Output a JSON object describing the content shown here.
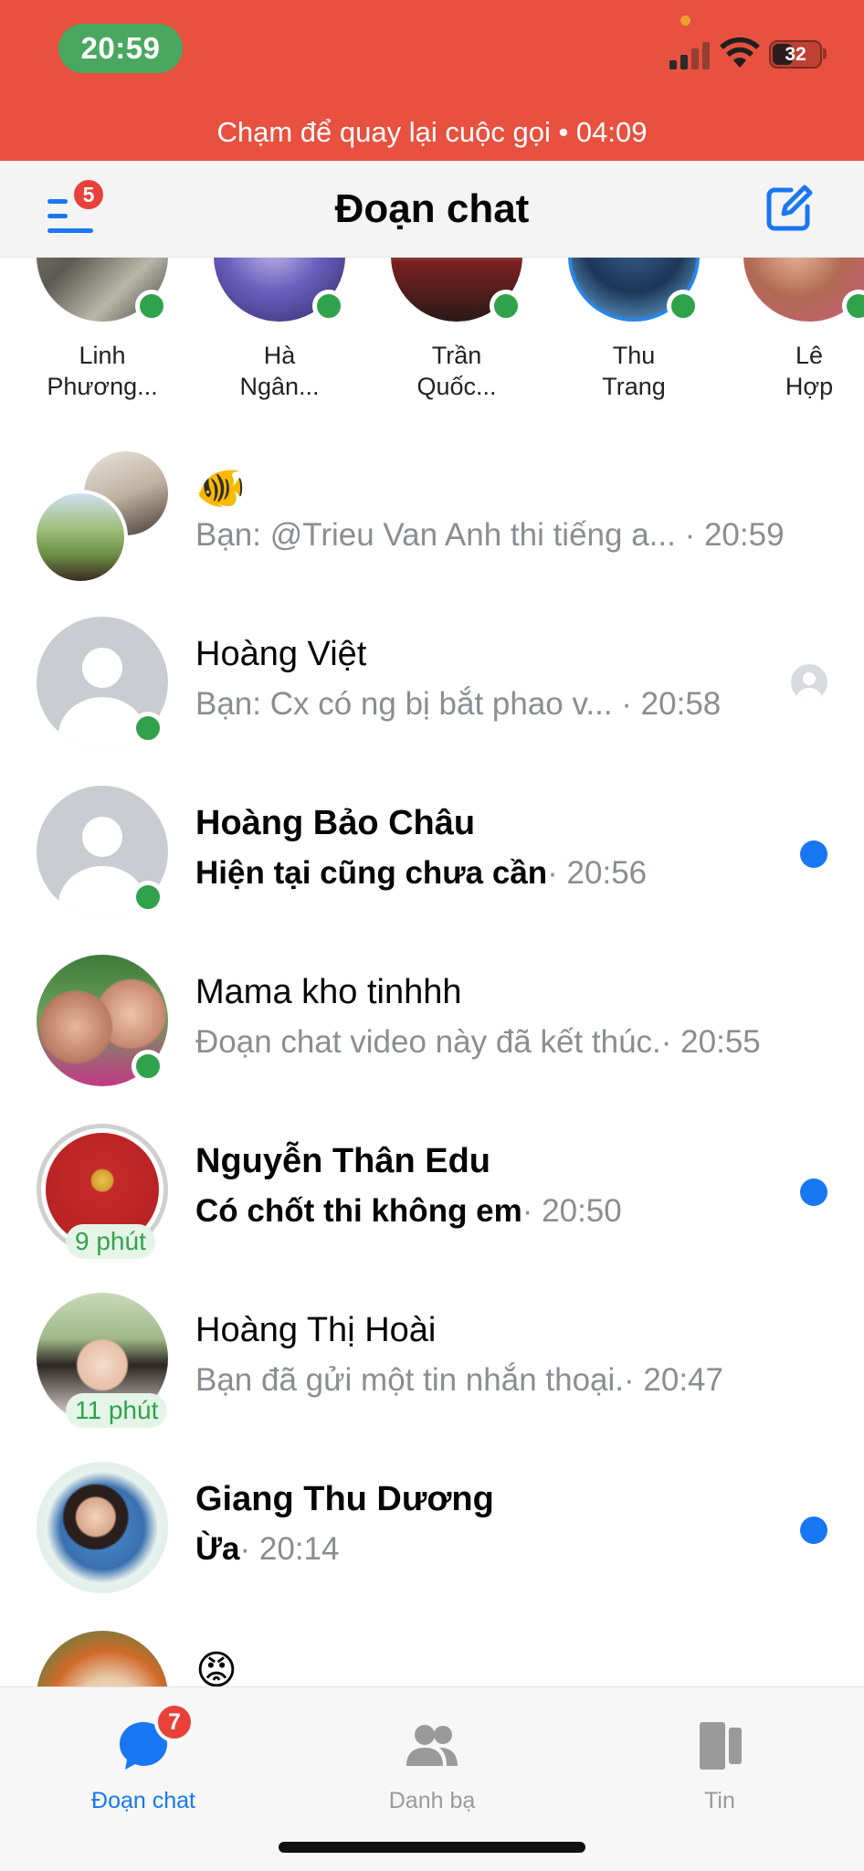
{
  "status_bar": {
    "time": "20:59",
    "battery": "32"
  },
  "call_banner": {
    "text": "Chạm để quay lại cuộc gọi • 04:09"
  },
  "header": {
    "title": "Đoạn chat",
    "menu_badge": "5"
  },
  "stories": [
    {
      "name": "Linh\nPhương..."
    },
    {
      "name": "Hà\nNgân..."
    },
    {
      "name": "Trần\nQuốc..."
    },
    {
      "name": "Thu\nTrang"
    },
    {
      "name": "Lê\nHợp"
    }
  ],
  "chats": [
    {
      "name": "🐠",
      "preview": "Bạn: @Trieu Van Anh  thi tiếng a...",
      "time": " · 20:59"
    },
    {
      "name": "Hoàng Việt",
      "preview": "Bạn: Cx có ng bị bắt phao v...",
      "time": " · 20:58"
    },
    {
      "name": "Hoàng Bảo Châu",
      "preview": "Hiện tại cũng chưa cần",
      "time": "· 20:56"
    },
    {
      "name": "Mama kho tinhhh",
      "preview": "Đoạn chat video này đã kết thúc.",
      "time": "· 20:55"
    },
    {
      "name": "Nguyễn Thân Edu",
      "preview": "Có chốt thi không em",
      "time": "· 20:50",
      "badge": "9 phút"
    },
    {
      "name": "Hoàng Thị Hoài",
      "preview": "Bạn đã gửi một tin nhắn thoại.",
      "time": "· 20:47",
      "badge": "11 phút"
    },
    {
      "name": "Giang Thu Dương",
      "preview": "Ừa",
      "time": "· 20:14"
    },
    {
      "name": "😡"
    }
  ],
  "bottom_nav": {
    "chats_label": "Đoạn chat",
    "chats_badge": "7",
    "contacts_label": "Danh bạ",
    "stories_label": "Tin"
  },
  "colors": {
    "accent": "#1877f2",
    "banner": "#e8503f",
    "online": "#31a24c",
    "badge": "#e8413a"
  }
}
